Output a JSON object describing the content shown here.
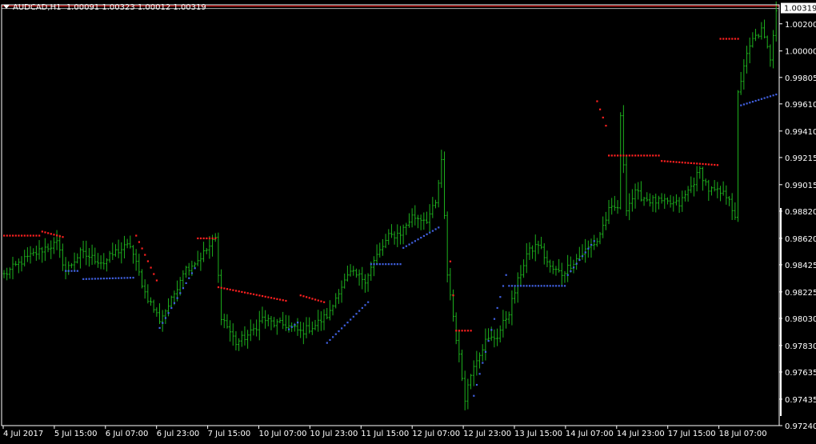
{
  "window": {
    "symbol": "AUDCAD,H1",
    "ohlc": "1.00091 1.00323 1.00012 1.00319"
  },
  "colors": {
    "background": "#000000",
    "axis": "#ffffff",
    "candle": "#1db01d",
    "sar_above": "#ff2020",
    "sar_below": "#4060e0",
    "price_tag": "#ffffff",
    "price_tag_text": "#000000",
    "ask_line": "#ff0000",
    "bid_line": "#b0b0b0"
  },
  "chart_data": {
    "type": "ohlc",
    "current_price": "1.00319",
    "y_ticks": [
      "1.00200",
      "1.00000",
      "0.99805",
      "0.99610",
      "0.99410",
      "0.99215",
      "0.99015",
      "0.98820",
      "0.98620",
      "0.98425",
      "0.98225",
      "0.98030",
      "0.97830",
      "0.97635",
      "0.97435",
      "0.97240"
    ],
    "x_ticks": [
      "4 Jul 2017",
      "5 Jul 15:00",
      "6 Jul 07:00",
      "6 Jul 23:00",
      "7 Jul 15:00",
      "10 Jul 07:00",
      "10 Jul 23:00",
      "11 Jul 15:00",
      "12 Jul 07:00",
      "12 Jul 23:00",
      "13 Jul 15:00",
      "14 Jul 07:00",
      "14 Jul 23:00",
      "17 Jul 15:00",
      "18 Jul 07:00"
    ],
    "ylim": [
      0.9724,
      1.0034
    ],
    "anchors": [
      [
        0,
        0.9835
      ],
      [
        6,
        0.9845
      ],
      [
        14,
        0.9855
      ],
      [
        18,
        0.9858
      ],
      [
        21,
        0.9838
      ],
      [
        26,
        0.9851
      ],
      [
        34,
        0.9844
      ],
      [
        38,
        0.9852
      ],
      [
        43,
        0.9857
      ],
      [
        48,
        0.9822
      ],
      [
        53,
        0.9802
      ],
      [
        57,
        0.9816
      ],
      [
        61,
        0.9838
      ],
      [
        66,
        0.9846
      ],
      [
        70,
        0.9856
      ],
      [
        72,
        0.9862
      ],
      [
        74,
        0.9805
      ],
      [
        79,
        0.9785
      ],
      [
        84,
        0.9792
      ],
      [
        88,
        0.9803
      ],
      [
        92,
        0.9799
      ],
      [
        96,
        0.9798
      ],
      [
        101,
        0.9793
      ],
      [
        106,
        0.9798
      ],
      [
        111,
        0.9807
      ],
      [
        114,
        0.9824
      ],
      [
        118,
        0.9836
      ],
      [
        123,
        0.9832
      ],
      [
        127,
        0.9849
      ],
      [
        131,
        0.9863
      ],
      [
        135,
        0.9866
      ],
      [
        139,
        0.9878
      ],
      [
        144,
        0.9876
      ],
      [
        147,
        0.9887
      ],
      [
        149,
        0.9918
      ],
      [
        151,
        0.9836
      ],
      [
        154,
        0.9789
      ],
      [
        157,
        0.9745
      ],
      [
        160,
        0.977
      ],
      [
        164,
        0.9786
      ],
      [
        168,
        0.979
      ],
      [
        172,
        0.9808
      ],
      [
        175,
        0.983
      ],
      [
        178,
        0.985
      ],
      [
        182,
        0.9858
      ],
      [
        186,
        0.984
      ],
      [
        190,
        0.9836
      ],
      [
        194,
        0.9845
      ],
      [
        198,
        0.9853
      ],
      [
        202,
        0.986
      ],
      [
        206,
        0.9882
      ],
      [
        209,
        0.9885
      ],
      [
        210,
        0.995
      ],
      [
        212,
        0.9885
      ],
      [
        215,
        0.9895
      ],
      [
        220,
        0.989
      ],
      [
        225,
        0.9888
      ],
      [
        230,
        0.9887
      ],
      [
        234,
        0.99
      ],
      [
        237,
        0.9912
      ],
      [
        240,
        0.9898
      ],
      [
        244,
        0.9895
      ],
      [
        247,
        0.9893
      ],
      [
        249,
        0.9875
      ],
      [
        250,
        0.9968
      ],
      [
        252,
        0.999
      ],
      [
        255,
        1.0008
      ],
      [
        258,
        1.0015
      ],
      [
        261,
        0.9995
      ],
      [
        263,
        1.0032
      ]
    ],
    "sar_segments": [
      {
        "side": "above",
        "from": 0,
        "to": 12,
        "start": 0.9864,
        "end": 0.9864
      },
      {
        "side": "above",
        "from": 13,
        "to": 20,
        "start": 0.9867,
        "end": 0.9863
      },
      {
        "side": "below",
        "from": 21,
        "to": 25,
        "start": 0.9838,
        "end": 0.9838
      },
      {
        "side": "below",
        "from": 27,
        "to": 44,
        "start": 0.9832,
        "end": 0.9833
      },
      {
        "side": "above",
        "from": 45,
        "to": 52,
        "start": 0.9864,
        "end": 0.9831
      },
      {
        "side": "below",
        "from": 53,
        "to": 65,
        "start": 0.9796,
        "end": 0.984
      },
      {
        "side": "above",
        "from": 66,
        "to": 72,
        "start": 0.9862,
        "end": 0.9862
      },
      {
        "side": "above",
        "from": 73,
        "to": 96,
        "start": 0.9826,
        "end": 0.9816
      },
      {
        "side": "below",
        "from": 97,
        "to": 100,
        "start": 0.9795,
        "end": 0.98
      },
      {
        "side": "above",
        "from": 101,
        "to": 109,
        "start": 0.982,
        "end": 0.9815
      },
      {
        "side": "below",
        "from": 110,
        "to": 124,
        "start": 0.9785,
        "end": 0.9815
      },
      {
        "side": "below",
        "from": 125,
        "to": 135,
        "start": 0.9843,
        "end": 0.9843
      },
      {
        "side": "below",
        "from": 136,
        "to": 148,
        "start": 0.9855,
        "end": 0.987
      },
      {
        "side": "above",
        "from": 152,
        "to": 153,
        "start": 0.9845,
        "end": 0.982
      },
      {
        "side": "above",
        "from": 154,
        "to": 159,
        "start": 0.9794,
        "end": 0.9794
      },
      {
        "side": "below",
        "from": 160,
        "to": 171,
        "start": 0.9746,
        "end": 0.9835
      },
      {
        "side": "below",
        "from": 172,
        "to": 191,
        "start": 0.9827,
        "end": 0.9827
      },
      {
        "side": "below",
        "from": 192,
        "to": 201,
        "start": 0.9835,
        "end": 0.986
      },
      {
        "side": "above",
        "from": 202,
        "to": 205,
        "start": 0.9963,
        "end": 0.9945
      },
      {
        "side": "above",
        "from": 206,
        "to": 223,
        "start": 0.9923,
        "end": 0.9923
      },
      {
        "side": "above",
        "from": 224,
        "to": 243,
        "start": 0.9919,
        "end": 0.9916
      },
      {
        "side": "above",
        "from": 244,
        "to": 250,
        "start": 1.0009,
        "end": 1.0009
      },
      {
        "side": "below",
        "from": 251,
        "to": 263,
        "start": 0.996,
        "end": 0.9968
      }
    ]
  }
}
